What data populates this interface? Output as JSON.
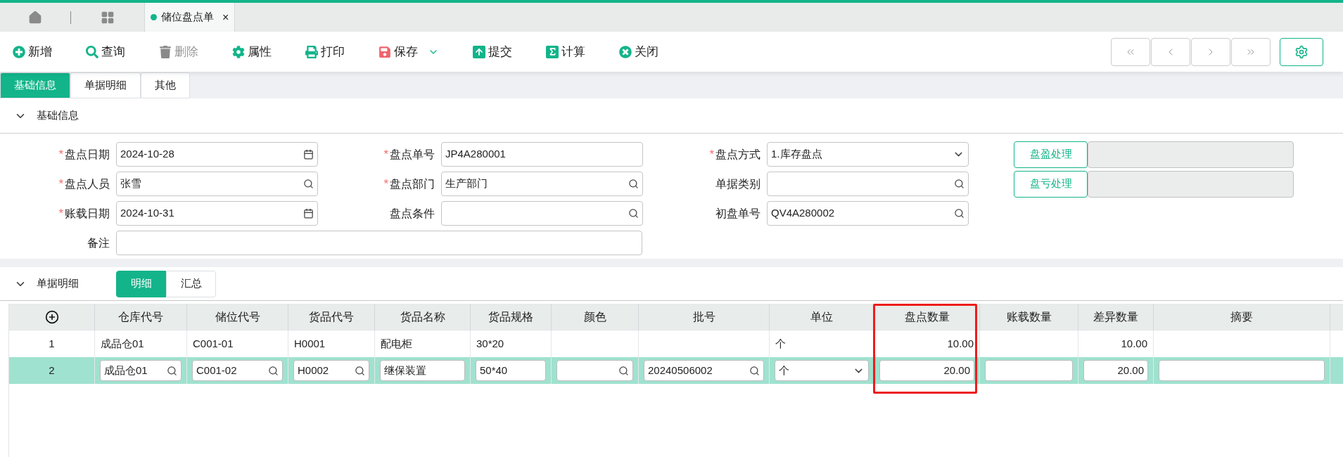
{
  "app_tabs": {
    "open_tabs": [
      {
        "title": "储位盘点单",
        "selected": true,
        "close": "×"
      }
    ]
  },
  "toolbar": {
    "buttons": [
      {
        "label": "新增",
        "disabled": false,
        "menu": false
      },
      {
        "label": "查询",
        "disabled": false,
        "menu": false
      },
      {
        "label": "删除",
        "disabled": true,
        "menu": false
      },
      {
        "label": "属性",
        "disabled": false,
        "menu": false
      },
      {
        "label": "打印",
        "disabled": false,
        "menu": false
      },
      {
        "label": "保存",
        "disabled": false,
        "menu": true
      },
      {
        "label": "提交",
        "disabled": false,
        "menu": false
      },
      {
        "label": "计算",
        "disabled": false,
        "menu": false
      },
      {
        "label": "关闭",
        "disabled": false,
        "menu": false
      }
    ]
  },
  "page_tabs": [
    {
      "label": "基础信息",
      "selected": true
    },
    {
      "label": "单据明细",
      "selected": false
    },
    {
      "label": "其他",
      "selected": false
    }
  ],
  "basic_section": {
    "title": "基础信息",
    "expanded": true,
    "rows": [
      {
        "fields": [
          {
            "label": "盘点日期",
            "required_mark": "*",
            "kind": "date",
            "value": "2024-10-28"
          },
          {
            "label": "盘点单号",
            "required_mark": "*",
            "kind": "text",
            "value": "JP4A280001"
          },
          {
            "label": "盘点方式",
            "required_mark": "*",
            "kind": "select",
            "value": "1.库存盘点"
          }
        ]
      },
      {
        "fields": [
          {
            "label": "盘点人员",
            "required_mark": "*",
            "kind": "lookup",
            "value": "张雪"
          },
          {
            "label": "盘点部门",
            "required_mark": "*",
            "kind": "lookup",
            "value": "生产部门"
          },
          {
            "label": "单据类别",
            "kind": "lookup"
          }
        ]
      },
      {
        "fields": [
          {
            "label": "账载日期",
            "required_mark": "*",
            "kind": "date",
            "value": "2024-10-31"
          },
          {
            "label": "盘点条件",
            "kind": "lookup"
          },
          {
            "label": "初盘单号",
            "kind": "lookup",
            "value": "QV4A280002"
          }
        ]
      },
      {
        "fields": [
          {
            "label": "备注",
            "kind": "wide"
          }
        ]
      }
    ],
    "action_buttons": [
      {
        "label": "盘盈处理"
      },
      {
        "label": "盘亏处理"
      }
    ]
  },
  "detail_section": {
    "title": "单据明细",
    "expanded": true,
    "views": [
      {
        "label": "明细",
        "selected": true
      },
      {
        "label": "汇总",
        "selected": false
      }
    ]
  },
  "table": {
    "columns": [
      {
        "label": "仓库代号",
        "kind": "lookup",
        "highlighted": false
      },
      {
        "label": "储位代号",
        "kind": "lookup",
        "highlighted": false
      },
      {
        "label": "货品代号",
        "kind": "lookup",
        "highlighted": false
      },
      {
        "label": "货品名称",
        "kind": "text",
        "highlighted": false
      },
      {
        "label": "货品规格",
        "kind": "text",
        "highlighted": false
      },
      {
        "label": "颜色",
        "kind": "lookup",
        "highlighted": false
      },
      {
        "label": "批号",
        "kind": "lookup",
        "highlighted": false
      },
      {
        "label": "单位",
        "kind": "select",
        "highlighted": false
      },
      {
        "label": "盘点数量",
        "kind": "number",
        "highlighted": true
      },
      {
        "label": "账载数量",
        "kind": "number",
        "highlighted": false
      },
      {
        "label": "差异数量",
        "kind": "number",
        "highlighted": false
      },
      {
        "label": "摘要",
        "kind": "text",
        "highlighted": false
      }
    ],
    "rows": [
      {
        "index": "1",
        "selected": false,
        "cells": [
          "成品仓01",
          "C001-01",
          "H0001",
          "配电柜",
          "30*20",
          null,
          null,
          "个",
          "10.00",
          null,
          "10.00",
          null
        ]
      },
      {
        "index": "2",
        "selected": true,
        "cells": [
          "成品仓01",
          "C001-02",
          "H0002",
          "继保装置",
          "50*40",
          null,
          "20240506002",
          "个",
          "20.00",
          null,
          "20.00",
          null
        ]
      }
    ]
  }
}
